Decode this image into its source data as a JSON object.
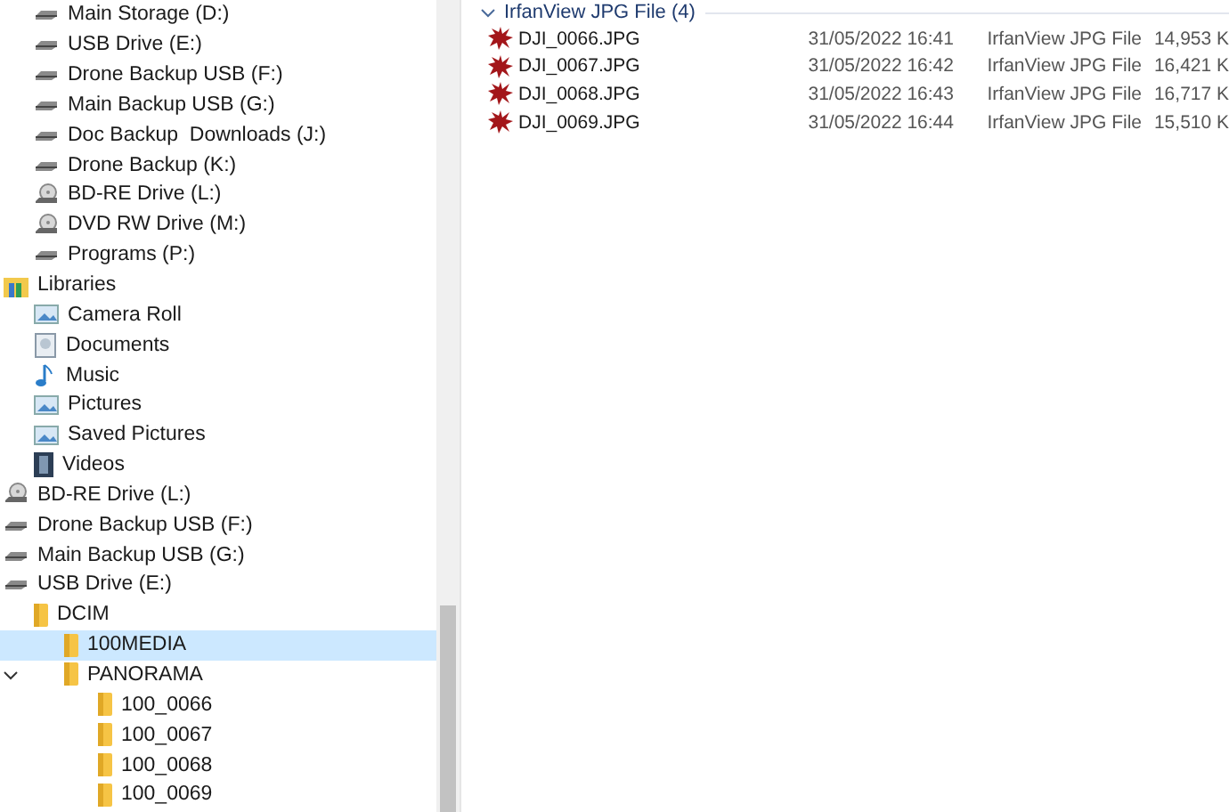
{
  "sidebar": {
    "drives": [
      {
        "label": "Main Storage (D:)",
        "kind": "drive",
        "selected": false
      },
      {
        "label": "USB Drive (E:)",
        "kind": "drive",
        "selected": false
      },
      {
        "label": "Drone Backup USB (F:)",
        "kind": "drive",
        "selected": false
      },
      {
        "label": "Main Backup USB (G:)",
        "kind": "drive",
        "selected": false
      },
      {
        "label": "Doc Backup  Downloads (J:)",
        "kind": "drive",
        "selected": false
      },
      {
        "label": "Drone Backup (K:)",
        "kind": "drive",
        "selected": false
      },
      {
        "label": "BD-RE Drive (L:)",
        "kind": "disc",
        "selected": false
      },
      {
        "label": "DVD RW Drive (M:)",
        "kind": "disc",
        "selected": false
      },
      {
        "label": "Programs (P:)",
        "kind": "drive",
        "selected": false
      }
    ],
    "tree": [
      {
        "label": "Libraries",
        "kind": "library",
        "selected": false,
        "children": [
          {
            "label": "Camera Roll",
            "kind": "picture",
            "selected": false
          },
          {
            "label": "Documents",
            "kind": "document",
            "selected": false
          },
          {
            "label": "Music",
            "kind": "music",
            "selected": false
          },
          {
            "label": "Pictures",
            "kind": "picture",
            "selected": false
          },
          {
            "label": "Saved Pictures",
            "kind": "picture",
            "selected": false
          },
          {
            "label": "Videos",
            "kind": "video",
            "selected": false
          }
        ]
      },
      {
        "label": "BD-RE Drive (L:)",
        "kind": "disc",
        "selected": false
      },
      {
        "label": "Drone Backup USB (F:)",
        "kind": "drive",
        "selected": false
      },
      {
        "label": "Main Backup USB (G:)",
        "kind": "drive",
        "selected": false
      },
      {
        "label": "USB Drive (E:)",
        "kind": "drive",
        "selected": false,
        "children": [
          {
            "label": "DCIM",
            "kind": "folder",
            "selected": false,
            "children": [
              {
                "label": "100MEDIA",
                "kind": "folder",
                "selected": true
              },
              {
                "label": "PANORAMA",
                "kind": "folder",
                "selected": false,
                "expanded": true,
                "children": [
                  {
                    "label": "100_0066",
                    "kind": "folder",
                    "selected": false
                  },
                  {
                    "label": "100_0067",
                    "kind": "folder",
                    "selected": false
                  },
                  {
                    "label": "100_0068",
                    "kind": "folder",
                    "selected": false
                  },
                  {
                    "label": "100_0069",
                    "kind": "folder",
                    "selected": false
                  }
                ]
              }
            ]
          }
        ]
      }
    ]
  },
  "files": {
    "group": {
      "label": "IrfanView JPG File (4)",
      "expanded": true
    },
    "rows": [
      {
        "name": "DJI_0066.JPG",
        "date": "31/05/2022 16:41",
        "type": "IrfanView JPG File",
        "size": "14,953 K"
      },
      {
        "name": "DJI_0067.JPG",
        "date": "31/05/2022 16:42",
        "type": "IrfanView JPG File",
        "size": "16,421 K"
      },
      {
        "name": "DJI_0068.JPG",
        "date": "31/05/2022 16:43",
        "type": "IrfanView JPG File",
        "size": "16,717 K"
      },
      {
        "name": "DJI_0069.JPG",
        "date": "31/05/2022 16:44",
        "type": "IrfanView JPG File",
        "size": "15,510 K"
      }
    ]
  }
}
